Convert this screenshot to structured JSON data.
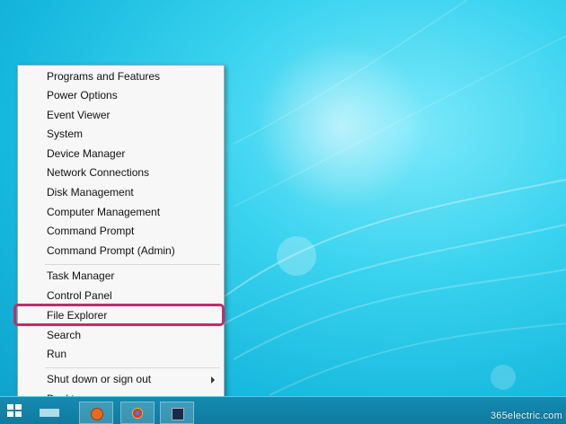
{
  "context_menu": {
    "items": [
      "Programs and Features",
      "Power Options",
      "Event Viewer",
      "System",
      "Device Manager",
      "Network Connections",
      "Disk Management",
      "Computer Management",
      "Command Prompt",
      "Command Prompt (Admin)",
      "Task Manager",
      "Control Panel",
      "File Explorer",
      "Search",
      "Run",
      "Shut down or sign out",
      "Desktop"
    ],
    "highlighted_item": "File Explorer",
    "highlight_color": "#c42a68"
  },
  "taskbar": {
    "start_icon": "windows-logo-icon",
    "buttons": [
      "firefox-icon",
      "chrome-icon",
      "terminal-icon"
    ]
  },
  "watermark": "365electric.com",
  "colors": {
    "desktop": "#16b8dd",
    "taskbar": "#0f7ba0"
  }
}
